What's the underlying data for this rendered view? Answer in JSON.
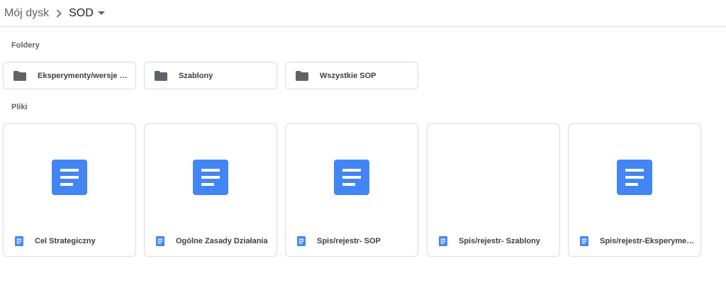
{
  "breadcrumb": {
    "root": "Mój dysk",
    "current": "SOD"
  },
  "sections": {
    "folders_label": "Foldery",
    "files_label": "Pliki"
  },
  "folders": [
    {
      "name": "Eksperymenty/wersje robocze",
      "icon": "folder-icon"
    },
    {
      "name": "Szablony",
      "icon": "folder-icon"
    },
    {
      "name": "Wszystkie SOP",
      "icon": "folder-icon"
    }
  ],
  "files": [
    {
      "name": "Cel Strategiczny",
      "icon": "google-docs-icon",
      "has_preview_icon": true
    },
    {
      "name": "Ogólne Zasady Działania",
      "icon": "google-docs-icon",
      "has_preview_icon": true
    },
    {
      "name": "Spis/rejestr- SOP",
      "icon": "google-docs-icon",
      "has_preview_icon": true
    },
    {
      "name": "Spis/rejestr- Szablony",
      "icon": "google-docs-icon",
      "has_preview_icon": false
    },
    {
      "name": "Spis/rejestr-Eksperymenty/wersje robocze",
      "icon": "google-docs-icon",
      "has_preview_icon": true
    }
  ],
  "colors": {
    "docs_blue": "#4285f4",
    "folder_gray": "#5f6368",
    "border": "#dadce0"
  }
}
